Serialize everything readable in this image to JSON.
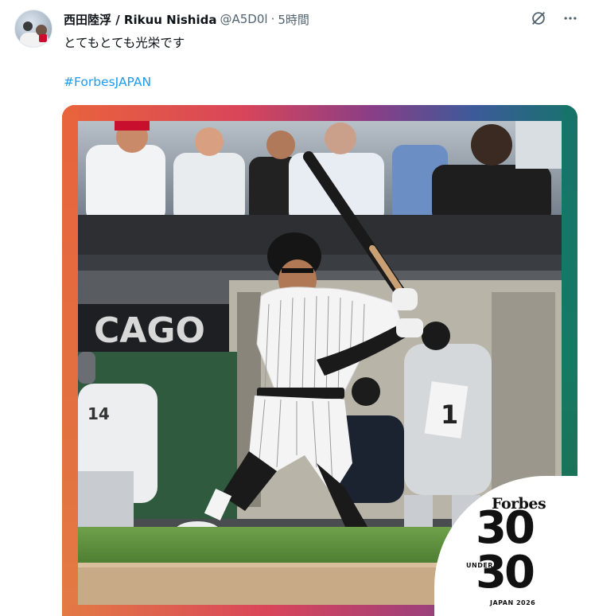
{
  "author": {
    "display_name": "西田陸浮 / Rikuu Nishida",
    "handle": "@A5D0l",
    "separator": "·",
    "time": "5時間"
  },
  "icons": {
    "grok": "grok-icon",
    "more": "more-icon"
  },
  "tweet": {
    "text": "とてもとても光栄です",
    "hashtag": "#ForbesJAPAN"
  },
  "media": {
    "scoreboard_text": "CAGO",
    "uniform_number": "14",
    "sign_number": "1",
    "badge": {
      "brand": "Forbes",
      "number_top": "30",
      "under": "UNDER",
      "number_bottom": "30",
      "edition": "JAPAN 2026"
    }
  },
  "colors": {
    "hashtag": "#1d9bf0",
    "text": "#0f1419",
    "muted": "#536471"
  }
}
